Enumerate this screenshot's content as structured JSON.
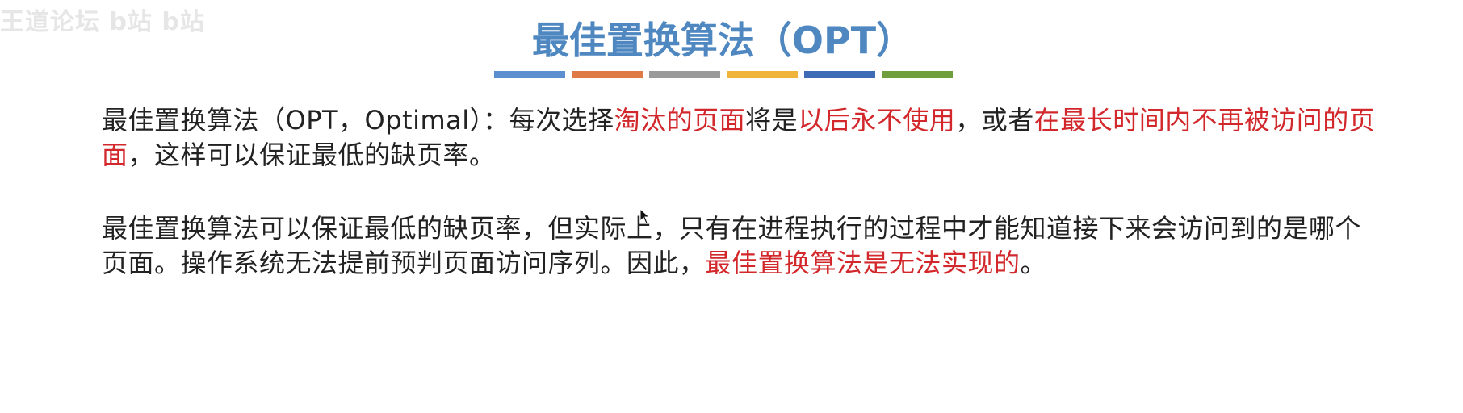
{
  "watermark": "王道论坛 b站 b站",
  "title": "最佳置换算法（OPT）",
  "title_bar_colors": [
    "#5b8fd0",
    "#e07a45",
    "#9a9a9a",
    "#f0b43a",
    "#3d6bb5",
    "#6e9f3c"
  ],
  "paragraph1": {
    "t1": "最佳置换算法（OPT，Optimal）：每次选择",
    "h1": "淘汰的页面",
    "t2": "将是",
    "h2": "以后永不使用",
    "t3": "，或者",
    "h3": "在最长时间内不再被访问的页面",
    "t4": "，这样可以保证最低的缺页率。"
  },
  "paragraph2": {
    "t1": "最佳置换算法可以保证最低的缺页率，但实际上，只有在进程执行的过程中才能知道接下来会访问到的是哪个页面。操作系统无法提前预判页面访问序列。因此，",
    "h1": "最佳置换算法是无法实现的",
    "t2": "。"
  },
  "colors": {
    "title": "#4f87c0",
    "highlight": "#d2282c",
    "body_text": "#222222"
  }
}
